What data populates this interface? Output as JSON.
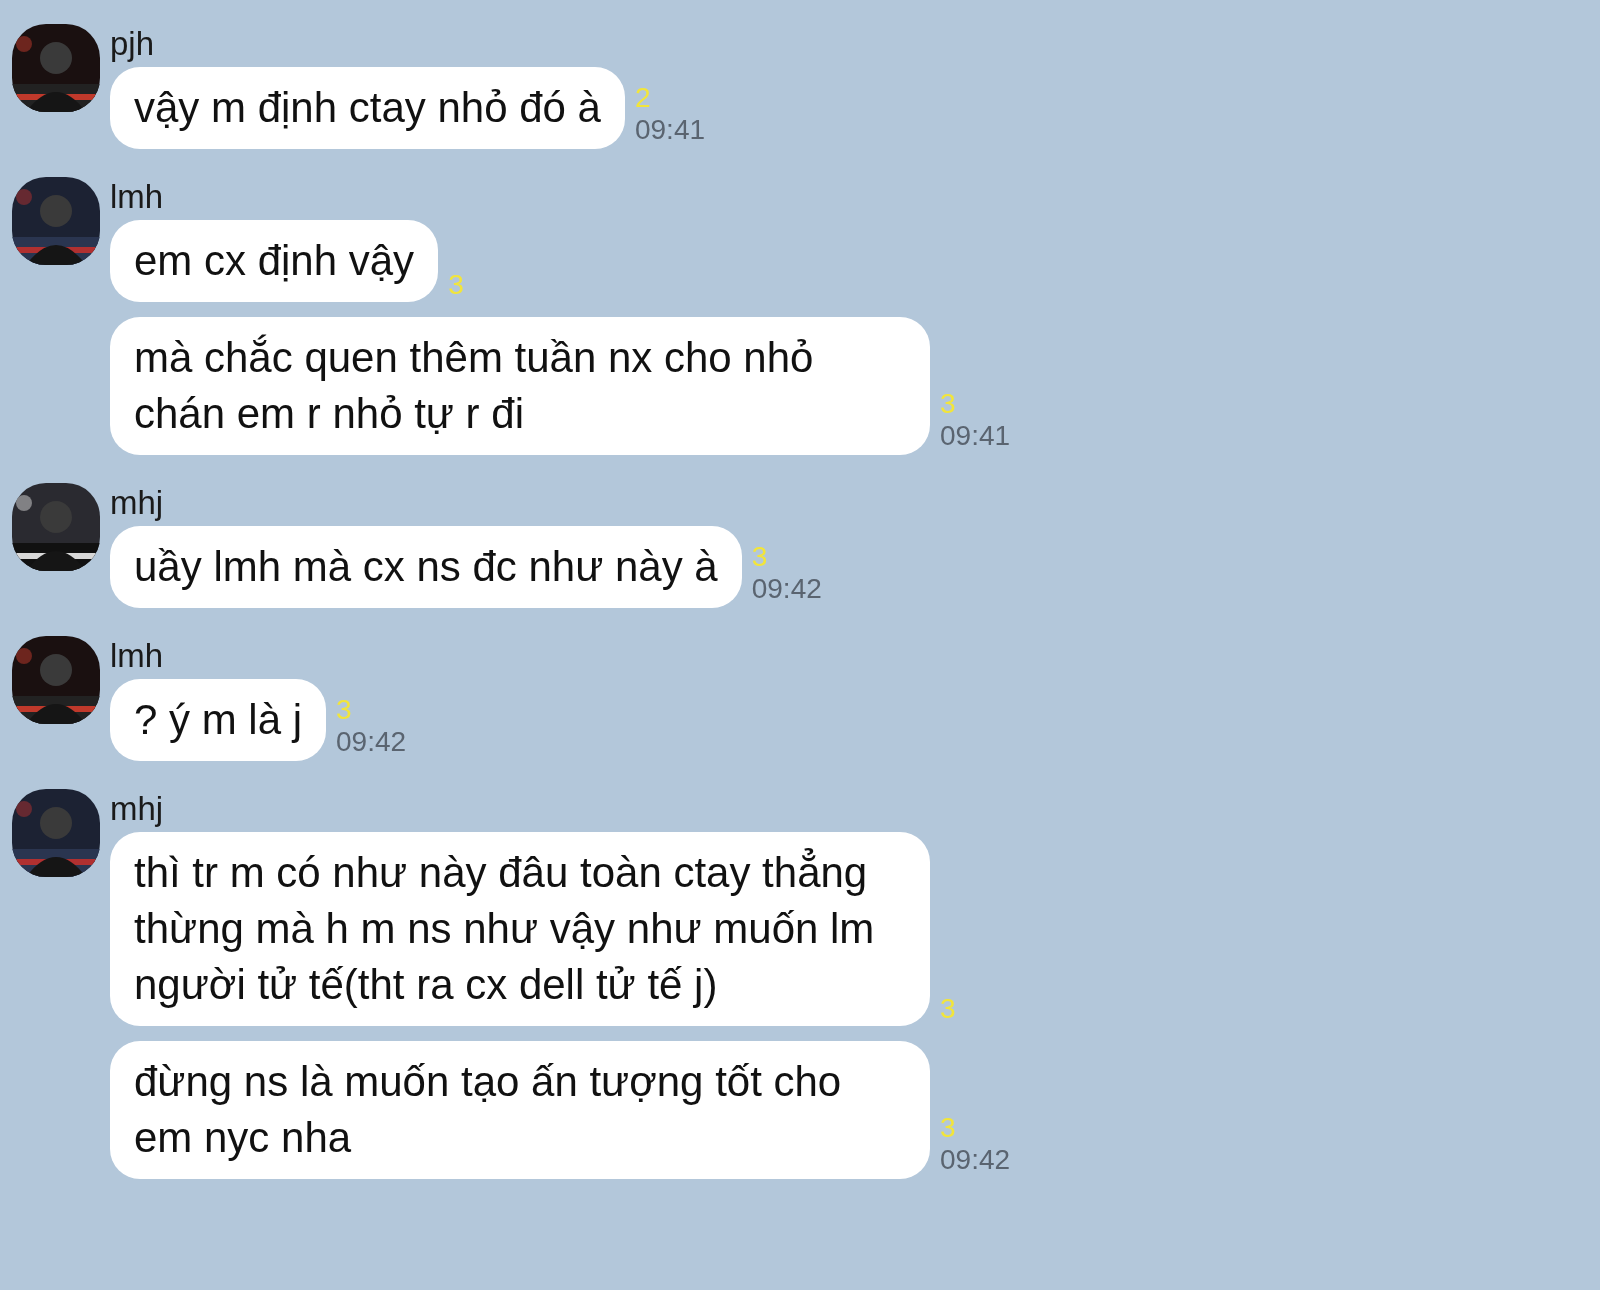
{
  "groups": [
    {
      "sender": "pjh",
      "messages": [
        {
          "text": "vậy m định ctay nhỏ đó à",
          "unread": "2",
          "time": "09:41"
        }
      ]
    },
    {
      "sender": "lmh",
      "messages": [
        {
          "text": "em cx định vậy",
          "unread": "3"
        },
        {
          "text": "mà chắc quen thêm tuần nx cho nhỏ chán em r nhỏ tự r đi",
          "unread": "3",
          "time": "09:41"
        }
      ]
    },
    {
      "sender": "mhj",
      "messages": [
        {
          "text": "uầy lmh mà cx ns đc như này à",
          "unread": "3",
          "time": "09:42"
        }
      ]
    },
    {
      "sender": "lmh",
      "messages": [
        {
          "text": "? ý m là j",
          "unread": "3",
          "time": "09:42"
        }
      ]
    },
    {
      "sender": "mhj",
      "messages": [
        {
          "text": "thì tr m có như này đâu toàn ctay thẳng thừng mà h m ns như vậy như muốn lm người tử tế(tht ra cx dell tử tế j)",
          "unread": "3"
        },
        {
          "text": "đừng ns là muốn tạo ấn tượng tốt cho em nyc nha",
          "unread": "3",
          "time": "09:42"
        }
      ]
    }
  ]
}
